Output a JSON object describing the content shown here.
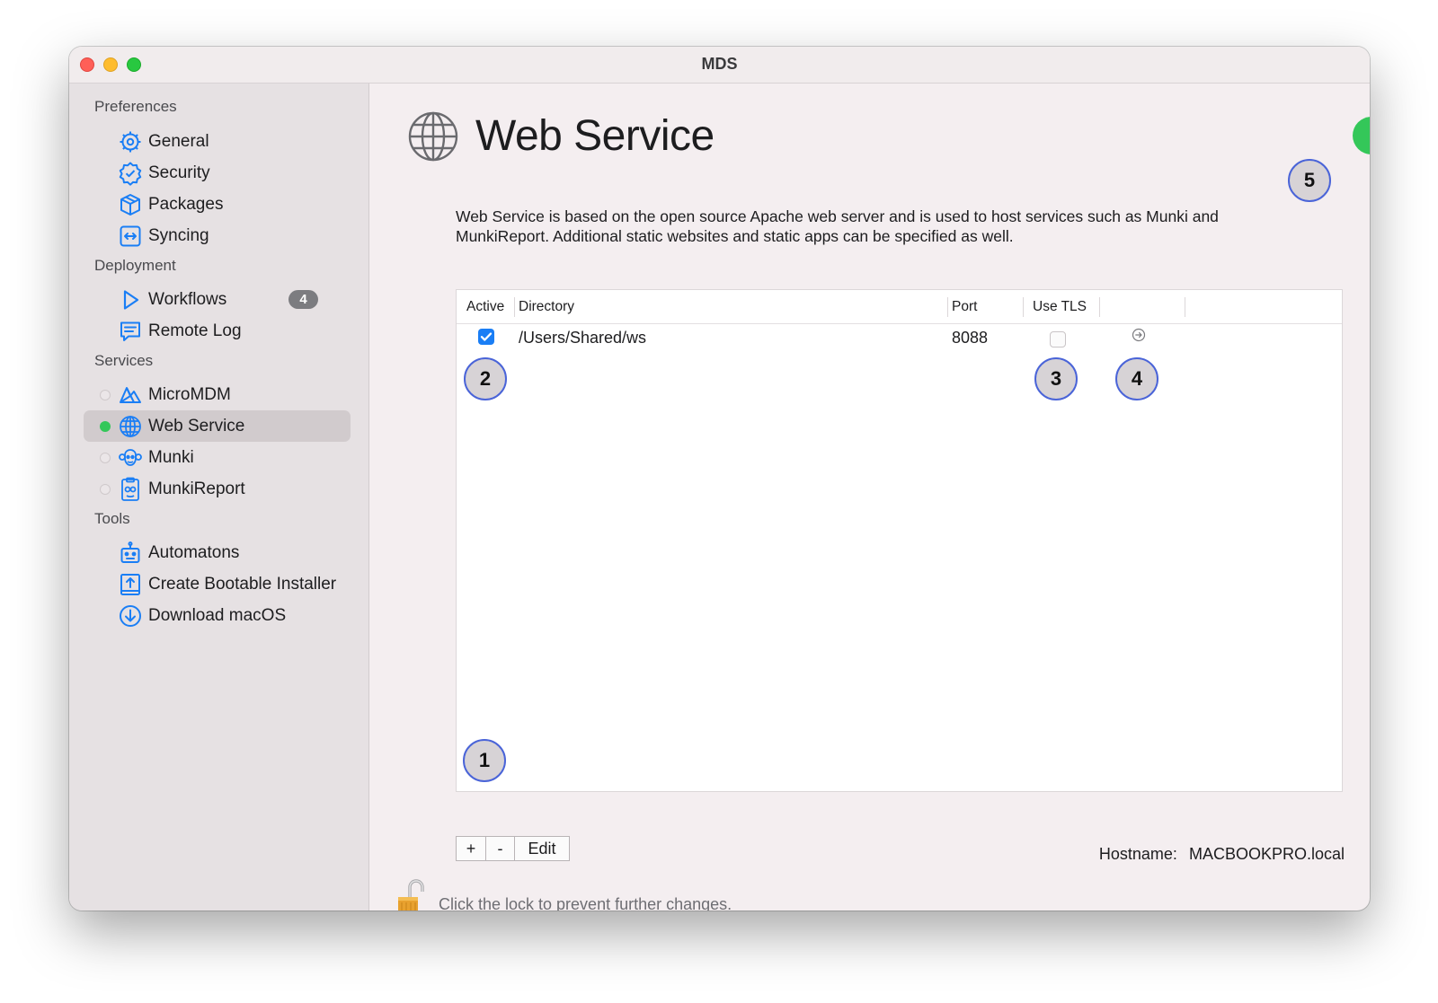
{
  "window": {
    "title": "MDS"
  },
  "sidebar": {
    "sections": [
      {
        "header": "Preferences",
        "items": [
          {
            "label": "General",
            "icon": "gear-icon"
          },
          {
            "label": "Security",
            "icon": "shield-check-icon"
          },
          {
            "label": "Packages",
            "icon": "package-icon"
          },
          {
            "label": "Syncing",
            "icon": "sync-icon"
          }
        ]
      },
      {
        "header": "Deployment",
        "items": [
          {
            "label": "Workflows",
            "icon": "play-icon",
            "badge": "4"
          },
          {
            "label": "Remote Log",
            "icon": "message-icon"
          }
        ]
      },
      {
        "header": "Services",
        "items": [
          {
            "label": "MicroMDM",
            "icon": "micromdm-icon",
            "status": "off"
          },
          {
            "label": "Web Service",
            "icon": "globe-icon",
            "status": "on",
            "selected": true
          },
          {
            "label": "Munki",
            "icon": "munki-icon",
            "status": "off"
          },
          {
            "label": "MunkiReport",
            "icon": "munkireport-icon",
            "status": "off"
          }
        ]
      },
      {
        "header": "Tools",
        "items": [
          {
            "label": "Automatons",
            "icon": "robot-icon"
          },
          {
            "label": "Create Bootable Installer",
            "icon": "installer-icon"
          },
          {
            "label": "Download macOS",
            "icon": "download-icon"
          }
        ]
      }
    ]
  },
  "main": {
    "title": "Web Service",
    "description": "Web Service is based on the open source Apache web server and is used to host services such as Munki and MunkiReport. Additional static websites and static apps can be specified as well.",
    "service_enabled": true,
    "table": {
      "columns": [
        "Active",
        "Directory",
        "Port",
        "Use TLS"
      ],
      "rows": [
        {
          "active": true,
          "directory": "/Users/Shared/ws",
          "port": "8088",
          "use_tls": false
        }
      ]
    },
    "buttons": {
      "add": "+",
      "remove": "-",
      "edit": "Edit"
    },
    "hostname_label": "Hostname:",
    "hostname_value": "MACBOOKPRO.local",
    "lock_message": "Click the lock to prevent further changes."
  },
  "callouts": [
    "1",
    "2",
    "3",
    "4",
    "5"
  ],
  "colors": {
    "accent": "#1a7ef5",
    "toggle_on": "#34c759",
    "callout_border": "#4a64d8"
  }
}
